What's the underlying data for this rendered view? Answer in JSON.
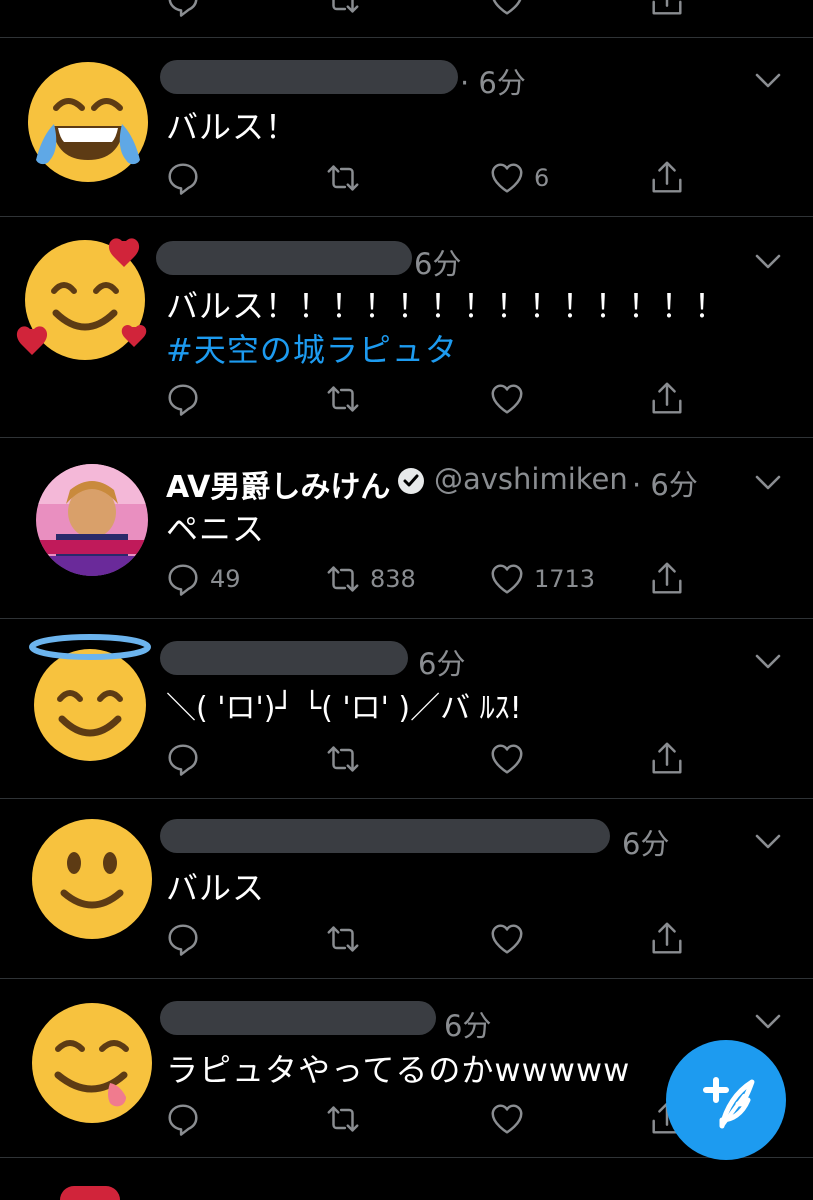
{
  "colors": {
    "background": "#000000",
    "divider": "#2f3336",
    "meta": "#8a8d91",
    "accent": "#1d9bf0",
    "emoji_yellow": "#f7c23e"
  },
  "tweets": [
    {
      "avatar": "face-with-tears-of-joy-emoji",
      "display_name": "",
      "handle": "",
      "time": "· 6分",
      "text": "バルス！",
      "hashtag": "",
      "reply_count": "",
      "retweet_count": "",
      "like_count": "6"
    },
    {
      "avatar": "smiling-face-with-hearts-emoji",
      "display_name": "",
      "handle": "",
      "time": "6分",
      "text": "バルス！！！！！！！！！！！！！！",
      "hashtag": "#天空の城ラピュタ",
      "reply_count": "",
      "retweet_count": "",
      "like_count": ""
    },
    {
      "avatar": "tv-screenshot-avatar",
      "display_name": "AV男爵しみけん",
      "handle": "@avshimiken",
      "time": "· 6分",
      "text": "ペニス",
      "hashtag": "",
      "reply_count": "49",
      "retweet_count": "838",
      "like_count": "1713"
    },
    {
      "avatar": "smiling-face-with-halo-emoji",
      "display_name": "",
      "handle": "",
      "time": "6分",
      "text": "＼( 'ロ')┘ └( 'ロ' )／バ ﾙｽ!",
      "hashtag": "",
      "reply_count": "",
      "retweet_count": "",
      "like_count": ""
    },
    {
      "avatar": "slightly-smiling-face-emoji",
      "display_name": "",
      "handle": "",
      "time": "6分",
      "text": "バルス",
      "hashtag": "",
      "reply_count": "",
      "retweet_count": "",
      "like_count": ""
    },
    {
      "avatar": "face-savoring-food-emoji",
      "display_name": "",
      "handle": "",
      "time": "6分",
      "text": "ラピュタやってるのかwwwww",
      "hashtag": "",
      "reply_count": "",
      "retweet_count": "",
      "like_count": ""
    }
  ],
  "compose_button": {
    "icon": "feather-plus-icon"
  }
}
